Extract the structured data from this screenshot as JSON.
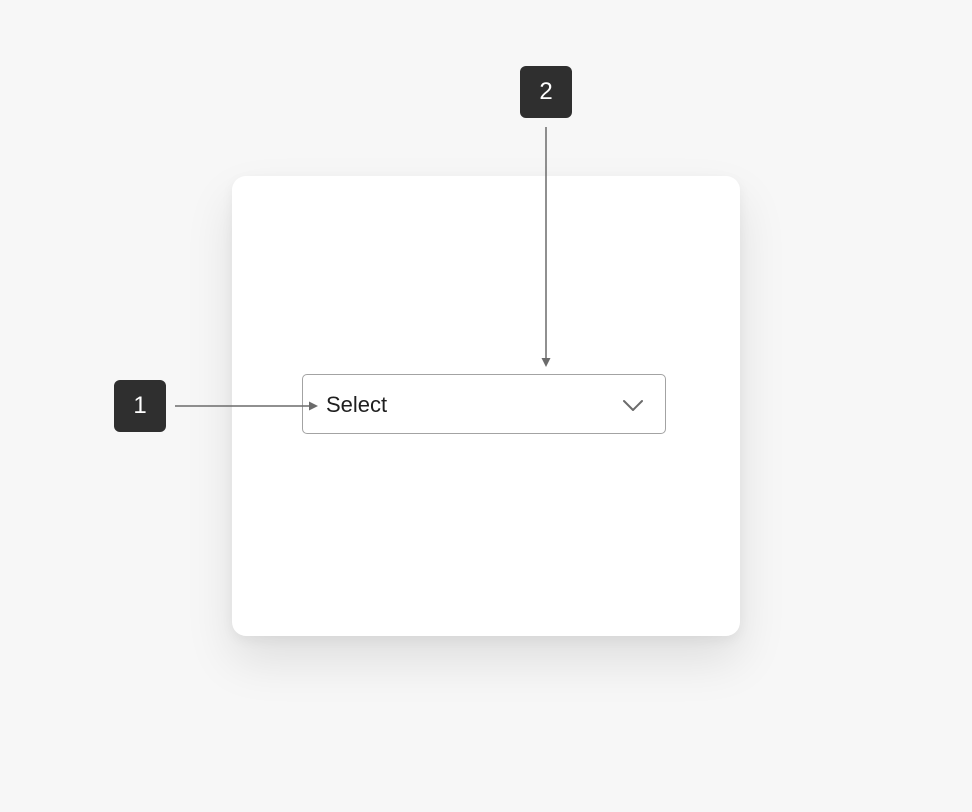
{
  "select": {
    "label": "Select",
    "icon": "chevron-down-icon"
  },
  "callouts": {
    "badge_1": "1",
    "badge_2": "2"
  },
  "colors": {
    "background": "#f7f7f7",
    "card": "#ffffff",
    "select_border": "#a3a3a3",
    "badge": "#2f2f2f",
    "callout_line": "#6b6b6b"
  }
}
